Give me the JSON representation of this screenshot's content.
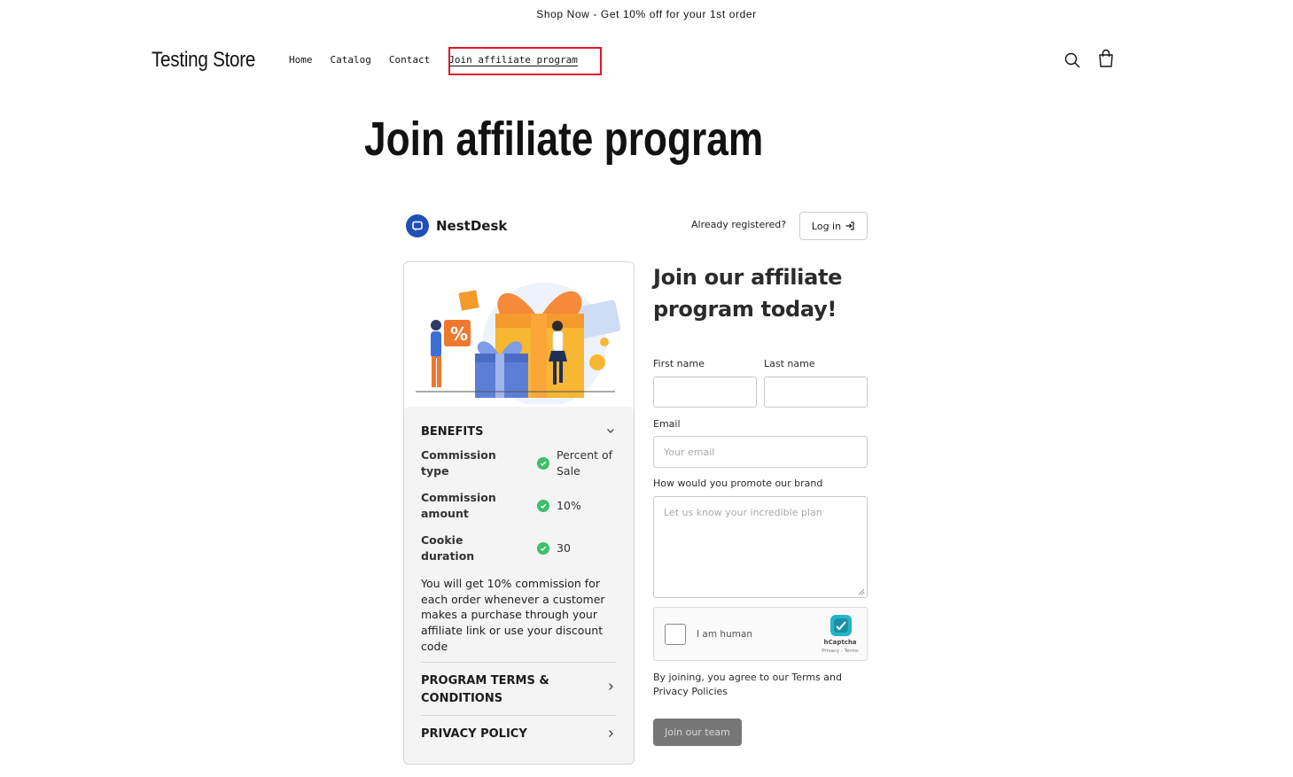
{
  "announcement": "Shop Now - Get 10% off for your 1st order",
  "header": {
    "store_name": "Testing Store",
    "nav": [
      "Home",
      "Catalog",
      "Contact",
      "Join affiliate program"
    ],
    "search_icon": "search-icon",
    "cart_icon": "bag-icon"
  },
  "page_title": "Join affiliate program",
  "widget": {
    "brand_name": "NestDesk",
    "already_registered": "Already registered?",
    "login_label": "Log in",
    "benefits": {
      "title": "BENEFITS",
      "rows": [
        {
          "label": "Commission type",
          "value": "Percent of Sale"
        },
        {
          "label": "Commission amount",
          "value": "10%"
        },
        {
          "label": "Cookie duration",
          "value": "30"
        }
      ],
      "description": "You will get 10%  commission for each order whenever a customer makes a purchase through your affiliate link or use your discount code"
    },
    "terms_title": "PROGRAM TERMS & CONDITIONS",
    "privacy_title": "PRIVACY POLICY",
    "form": {
      "title": "Join our affiliate program today!",
      "first_name_label": "First name",
      "last_name_label": "Last name",
      "email_label": "Email",
      "email_placeholder": "Your email",
      "promote_label": "How would you promote our brand",
      "promote_placeholder": "Let us know your incredible plan",
      "captcha_label": "I am human",
      "captcha_brand": "hCaptcha",
      "captcha_links": "Privacy - Terms",
      "agree_text": "By joining, you agree to our Terms and Privacy Policies",
      "submit_label": "Join our team"
    }
  },
  "colors": {
    "highlight": "#e3142b",
    "check": "#3fbf6b",
    "brand": "#1f4fb8",
    "submit_bg": "#777777"
  }
}
